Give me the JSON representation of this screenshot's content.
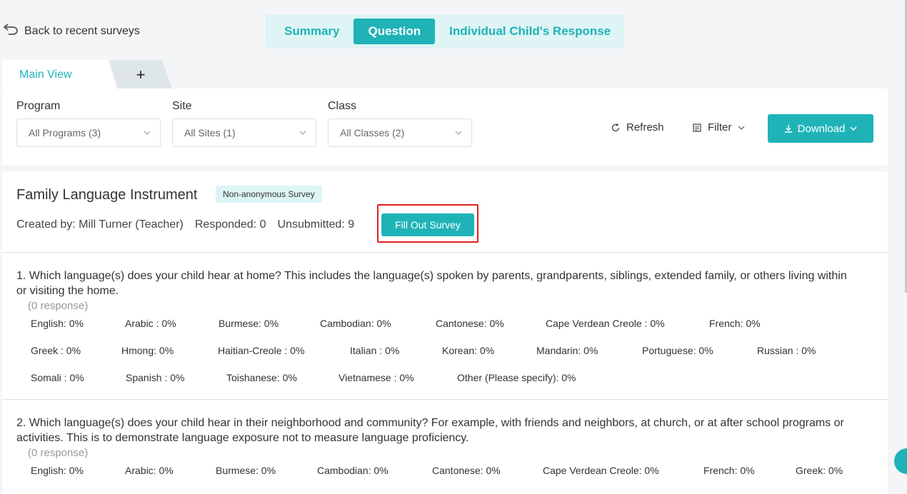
{
  "header": {
    "back_label": "Back to recent surveys",
    "tabs": [
      {
        "label": "Summary",
        "active": false
      },
      {
        "label": "Question",
        "active": true
      },
      {
        "label": "Individual Child's Response",
        "active": false
      }
    ]
  },
  "view_tabs": {
    "main_label": "Main View",
    "add_label": "+"
  },
  "filters": {
    "program": {
      "label": "Program",
      "value": "All Programs (3)"
    },
    "site": {
      "label": "Site",
      "value": "All Sites (1)"
    },
    "class": {
      "label": "Class",
      "value": "All Classes (2)"
    },
    "refresh_label": "Refresh",
    "filter_label": "Filter",
    "download_label": "Download"
  },
  "survey": {
    "title": "Family Language Instrument",
    "badge": "Non-anonymous Survey",
    "created_by": "Created by: Mill Turner (Teacher)",
    "responded": "Responded: 0",
    "unsubmitted": "Unsubmitted: 9",
    "fill_button": "Fill Out Survey"
  },
  "questions": [
    {
      "text": "1. Which language(s) does your child hear at home? This includes the language(s) spoken by parents, grandparents, siblings, extended family, or others living within or visiting the home.",
      "response": "(0 response)",
      "rows": [
        [
          "English: 0%",
          "Arabic : 0%",
          "Burmese: 0%",
          "Cambodian: 0%",
          "Cantonese: 0%",
          "Cape Verdean Creole : 0%",
          "French: 0%"
        ],
        [
          "Greek : 0%",
          "Hmong: 0%",
          "Haitian-Creole : 0%",
          "Italian : 0%",
          "Korean: 0%",
          "Mandarin: 0%",
          "Portuguese: 0%",
          "Russian : 0%"
        ],
        [
          "Somali : 0%",
          "Spanish : 0%",
          "Toishanese: 0%",
          "Vietnamese : 0%",
          "Other (Please specify): 0%"
        ]
      ]
    },
    {
      "text": "2. Which language(s) does your child hear in their neighborhood and community? For example, with friends and neighbors, at church, or at after school programs or activities. This is to demonstrate language exposure not to measure language proficiency.",
      "response": "(0 response)",
      "rows": [
        [
          "English: 0%",
          "Arabic: 0%",
          "Burmese: 0%",
          "Cambodian: 0%",
          "Cantonese: 0%",
          "Cape Verdean Creole: 0%",
          "French: 0%",
          "Greek: 0%"
        ]
      ]
    }
  ],
  "colors": {
    "accent": "#1fb3b8",
    "accent_light": "#def4f5",
    "highlight": "#e02020"
  }
}
